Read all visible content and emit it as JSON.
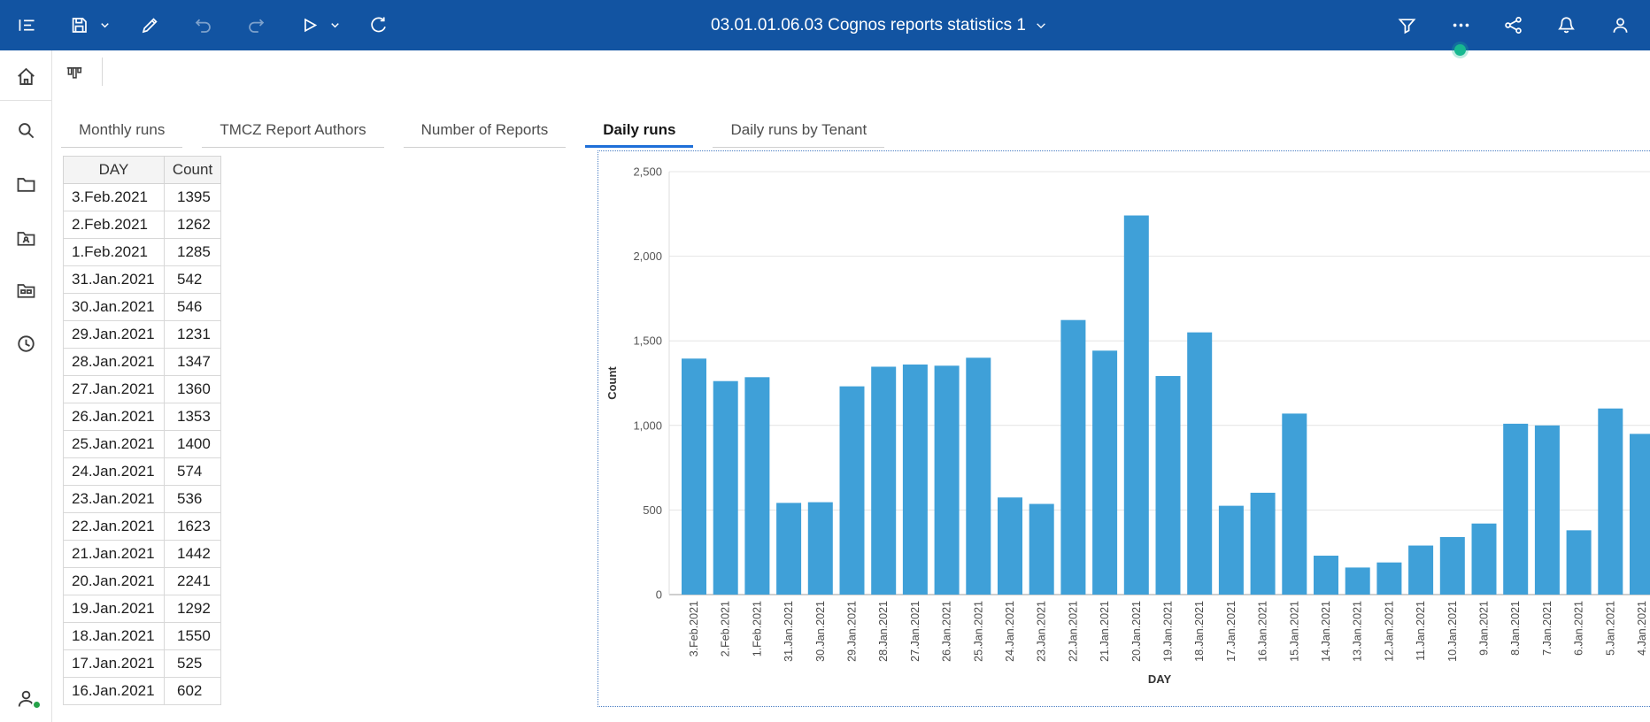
{
  "colors": {
    "topbar_bg": "#1254a2",
    "bar_fill": "#3fa0d8",
    "tab_active_underline": "#1f6fd8",
    "selection_border": "#4c7fc4",
    "status_green": "#24a148",
    "notification_dot": "#17b890"
  },
  "topbar": {
    "title": "03.01.01.06.03 Cognos reports statistics 1",
    "icons_left": [
      "open-menu-icon",
      "save-icon",
      "chevron-down-icon",
      "edit-pencil-icon",
      "undo-icon",
      "redo-icon",
      "run-play-icon",
      "chevron-down-icon",
      "refresh-icon"
    ],
    "icons_right": [
      "filter-icon",
      "more-ellipsis-icon",
      "share-icon",
      "notifications-bell-icon",
      "account-person-icon"
    ]
  },
  "content_toolbar": {
    "icons": [
      "widget-columns-icon"
    ]
  },
  "sidebar": {
    "icons": [
      "home-icon",
      "search-icon",
      "folder-icon",
      "user-folder-icon",
      "content-folder-icon",
      "recent-clock-icon"
    ],
    "bottom_icons": [
      "user-avatar-icon",
      "online-status-dot"
    ]
  },
  "tabs": [
    {
      "label": "Monthly runs",
      "active": false
    },
    {
      "label": "TMCZ Report Authors",
      "active": false
    },
    {
      "label": "Number of Reports",
      "active": false
    },
    {
      "label": "Daily runs",
      "active": true
    },
    {
      "label": "Daily runs by Tenant",
      "active": false
    }
  ],
  "table": {
    "columns": [
      "DAY",
      "Count"
    ],
    "rows": [
      [
        "3.Feb.2021",
        "1395"
      ],
      [
        "2.Feb.2021",
        "1262"
      ],
      [
        "1.Feb.2021",
        "1285"
      ],
      [
        "31.Jan.2021",
        "542"
      ],
      [
        "30.Jan.2021",
        "546"
      ],
      [
        "29.Jan.2021",
        "1231"
      ],
      [
        "28.Jan.2021",
        "1347"
      ],
      [
        "27.Jan.2021",
        "1360"
      ],
      [
        "26.Jan.2021",
        "1353"
      ],
      [
        "25.Jan.2021",
        "1400"
      ],
      [
        "24.Jan.2021",
        "574"
      ],
      [
        "23.Jan.2021",
        "536"
      ],
      [
        "22.Jan.2021",
        "1623"
      ],
      [
        "21.Jan.2021",
        "1442"
      ],
      [
        "20.Jan.2021",
        "2241"
      ],
      [
        "19.Jan.2021",
        "1292"
      ],
      [
        "18.Jan.2021",
        "1550"
      ],
      [
        "17.Jan.2021",
        "525"
      ],
      [
        "16.Jan.2021",
        "602"
      ]
    ]
  },
  "chart_data": {
    "type": "bar",
    "title": "",
    "xlabel": "DAY",
    "ylabel": "Count",
    "ylim": [
      0,
      2500
    ],
    "yticks": [
      0,
      500,
      1000,
      1500,
      2000,
      2500
    ],
    "ytick_labels": [
      "0",
      "500",
      "1,000",
      "1,500",
      "2,000",
      "2,500"
    ],
    "grid": true,
    "legend": "none",
    "categories": [
      "3.Feb.2021",
      "2.Feb.2021",
      "1.Feb.2021",
      "31.Jan.2021",
      "30.Jan.2021",
      "29.Jan.2021",
      "28.Jan.2021",
      "27.Jan.2021",
      "26.Jan.2021",
      "25.Jan.2021",
      "24.Jan.2021",
      "23.Jan.2021",
      "22.Jan.2021",
      "21.Jan.2021",
      "20.Jan.2021",
      "19.Jan.2021",
      "18.Jan.2021",
      "17.Jan.2021",
      "16.Jan.2021",
      "15.Jan.2021",
      "14.Jan.2021",
      "13.Jan.2021",
      "12.Jan.2021",
      "11.Jan.2021",
      "10.Jan.2021",
      "9.Jan.2021",
      "8.Jan.2021",
      "7.Jan.2021",
      "6.Jan.2021",
      "5.Jan.2021",
      "4.Jan.2021"
    ],
    "values": [
      1395,
      1262,
      1285,
      542,
      546,
      1231,
      1347,
      1360,
      1353,
      1400,
      574,
      536,
      1623,
      1442,
      2241,
      1292,
      1550,
      525,
      602,
      1070,
      230,
      160,
      190,
      290,
      340,
      420,
      1010,
      1000,
      380,
      1100,
      950
    ]
  }
}
